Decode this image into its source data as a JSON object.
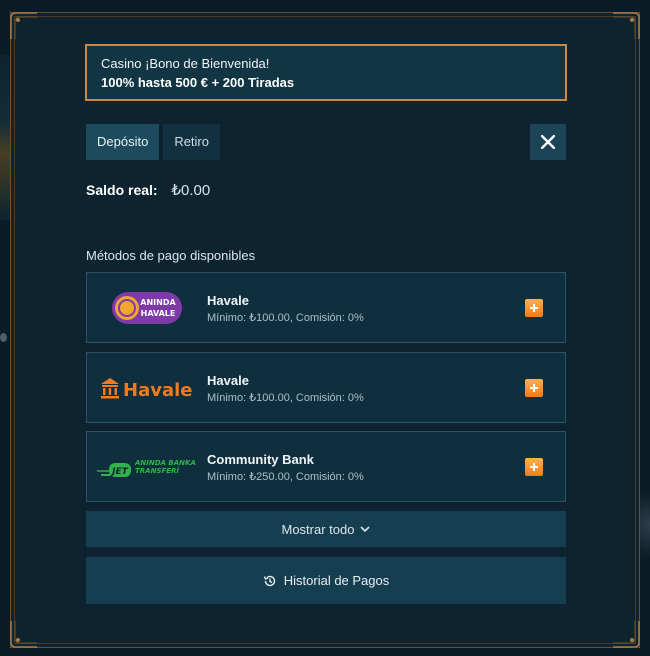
{
  "promo": {
    "line1": "Casino ¡Bono de Bienvenida!",
    "line2": "100% hasta 500 € + 200 Tiradas"
  },
  "tabs": [
    {
      "label": "Depósito",
      "active": true
    },
    {
      "label": "Retiro",
      "active": false
    }
  ],
  "balance": {
    "label": "Saldo real:",
    "value": "₺0.00"
  },
  "methods_title": "Métodos de pago disponibles",
  "methods": [
    {
      "name": "Havale",
      "info": "Mínimo: ₺100.00, Comisión: 0%",
      "logo": "aninda-havale-logo",
      "logo_text": "ANINDA HAVALE"
    },
    {
      "name": "Havale",
      "info": "Mínimo: ₺100.00, Comisión: 0%",
      "logo": "havale-logo",
      "logo_text": "Havale"
    },
    {
      "name": "Community Bank",
      "info": "Mínimo: ₺250.00, Comisión: 0%",
      "logo": "jet-logo",
      "logo_text": "JET ANINDA BANKA TRANSFERİ"
    }
  ],
  "show_all_label": "Mostrar todo",
  "history_label": "Historial de Pagos",
  "colors": {
    "accent": "#f27a1a",
    "border_gold": "#c88a4a",
    "panel": "#102f3e"
  }
}
